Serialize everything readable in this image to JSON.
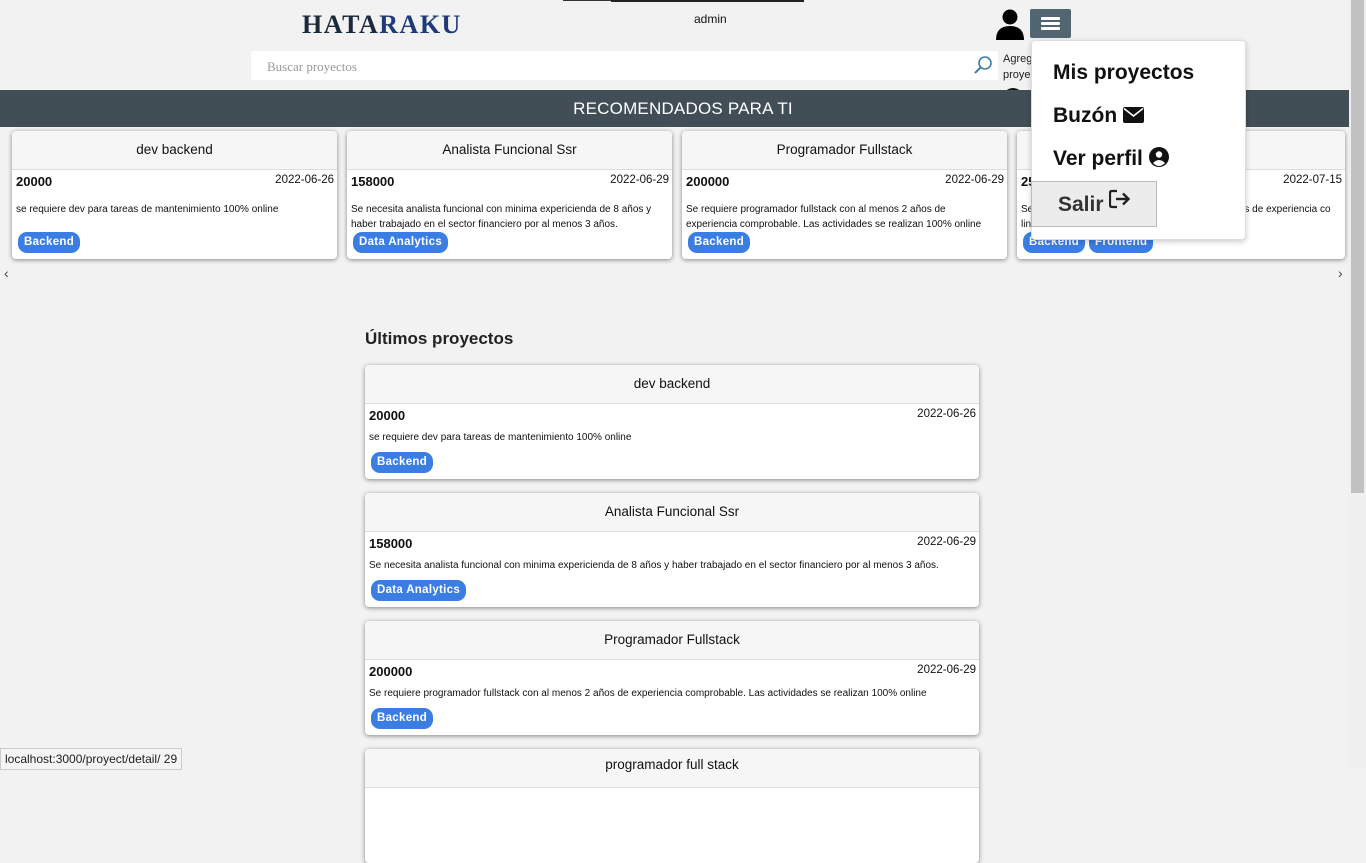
{
  "header": {
    "logo_part1": "HATA",
    "logo_part2": "RAKU",
    "username": "admin",
    "search_placeholder": "Buscar proyectos",
    "add_project_line1": "Agregar",
    "add_project_line2": "proyecto",
    "add_icon": "plus-circle-icon",
    "user_icon": "user-silhouette-icon",
    "menu_icon": "hamburger-menu-icon"
  },
  "banner": {
    "title": "RECOMENDADOS PARA TI"
  },
  "recommended": [
    {
      "title": "dev backend",
      "amount": "20000",
      "date": "2022-06-26",
      "desc": "se requiere dev para tareas de mantenimiento 100% online",
      "tags": [
        "Backend"
      ]
    },
    {
      "title": "Analista Funcional Ssr",
      "amount": "158000",
      "date": "2022-06-29",
      "desc": "Se necesita analista funcional con minima expericienda de 8 años y haber trabajado en el sector financiero por al menos 3 años.",
      "tags": [
        "Data Analytics"
      ]
    },
    {
      "title": "Programador Fullstack",
      "amount": "200000",
      "date": "2022-06-29",
      "desc": "Se requiere programador fullstack con al menos 2 años de experiencia comprobable. Las actividades se realizan 100% online",
      "tags": [
        "Backend"
      ]
    },
    {
      "title": "",
      "amount": "25",
      "date": "2022-07-15",
      "desc": "Se                                                                      años de experiencia co                                                                      line",
      "tags": [
        "Backend",
        "Frontend"
      ]
    }
  ],
  "latest": {
    "title": "Últimos proyectos",
    "items": [
      {
        "title": "dev backend",
        "amount": "20000",
        "date": "2022-06-26",
        "desc": "se requiere dev para tareas de mantenimiento 100% online",
        "tags": [
          "Backend"
        ]
      },
      {
        "title": "Analista Funcional Ssr",
        "amount": "158000",
        "date": "2022-06-29",
        "desc": "Se necesita analista funcional con minima expericienda de 8 años y haber trabajado en el sector financiero por al menos 3 años.",
        "tags": [
          "Data Analytics"
        ]
      },
      {
        "title": "Programador Fullstack",
        "amount": "200000",
        "date": "2022-06-29",
        "desc": "Se requiere programador fullstack con al menos 2 años de experiencia comprobable. Las actividades se realizan 100% online",
        "tags": [
          "Backend"
        ]
      },
      {
        "title": "programador full stack",
        "amount": "",
        "date": "",
        "desc": "",
        "tags": []
      }
    ]
  },
  "menu": {
    "items": [
      {
        "label": "Mis proyectos",
        "icon": ""
      },
      {
        "label": "Buzón",
        "icon": "envelope-icon"
      },
      {
        "label": "Ver perfil",
        "icon": "user-circle-icon"
      }
    ],
    "logout_label": "Salir",
    "logout_icon": "sign-out-icon"
  },
  "carousel": {
    "prev_icon": "chevron-left-icon",
    "next_icon": "chevron-right-icon"
  },
  "status_url": "localhost:3000/proyect/detail/ 29",
  "colors": {
    "banner": "#414e56",
    "badge": "#3a7ee4",
    "menu_button": "#526672"
  }
}
